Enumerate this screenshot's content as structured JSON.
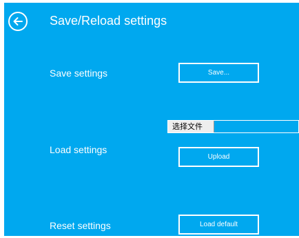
{
  "header": {
    "title": "Save/Reload settings",
    "back_icon": "arrow-left-circle-icon"
  },
  "save_section": {
    "label": "Save settings",
    "button_label": "Save..."
  },
  "load_section": {
    "label": "Load settings",
    "file_choose_label": "选择文件",
    "upload_label": "Upload"
  },
  "reset_section": {
    "label": "Reset settings",
    "button_label": "Load default"
  },
  "colors": {
    "background": "#00a8ef",
    "text": "#ffffff"
  }
}
